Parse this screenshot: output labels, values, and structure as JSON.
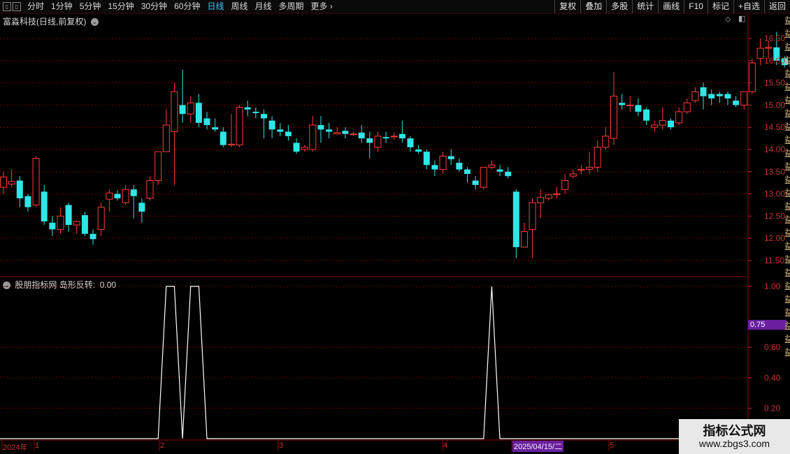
{
  "toolbar": {
    "periods": [
      "分时",
      "1分钟",
      "5分钟",
      "15分钟",
      "30分钟",
      "60分钟",
      "日线",
      "周线",
      "月线",
      "多周期",
      "更多"
    ],
    "active_period": "日线",
    "tools": [
      "复权",
      "叠加",
      "多股",
      "统计",
      "画线",
      "F10",
      "标记",
      "+自选",
      "返回"
    ]
  },
  "main_header": {
    "title": "富淼科技(日线,前复权)"
  },
  "indicator_header": {
    "name": "股朋指标网",
    "label": "岛形反转",
    "value": "0.00"
  },
  "price_axis": {
    "ticks": [
      "16.50",
      "16.00",
      "15.50",
      "15.00",
      "14.50",
      "14.00",
      "13.50",
      "13.00",
      "12.50",
      "12.00",
      "11.50"
    ]
  },
  "indicator_axis": {
    "ticks": [
      "1.00",
      "0.75",
      "0.60",
      "0.40",
      "0.20"
    ],
    "highlight": "0.75"
  },
  "date_axis": {
    "labels": [
      "2024年",
      "1",
      "2",
      "3",
      "4",
      "2025/04/15/二",
      "5"
    ],
    "highlight": "2025/04/15/二"
  },
  "right_strip_text": "益益益益益益益益益益益益益益益益益益益益益益益益益益",
  "watermark": {
    "title": "指标公式网",
    "url": "www.zbgs3.com"
  },
  "colors": {
    "up": "#ff3c3c",
    "down": "#2fe6e6",
    "grid": "#7a0000",
    "indicator_line": "#ffffff"
  },
  "chart_data": {
    "type": "candlestick",
    "title": "富淼科技(日线,前复权)",
    "ylim": [
      11.2,
      16.8
    ],
    "candles": [
      [
        13.15,
        13.38,
        13.5,
        13.0
      ],
      [
        13.22,
        13.28,
        13.55,
        13.15
      ],
      [
        13.3,
        12.9,
        13.4,
        12.7
      ],
      [
        12.95,
        12.7,
        13.0,
        12.6
      ],
      [
        12.75,
        13.8,
        13.85,
        12.7
      ],
      [
        13.05,
        12.38,
        13.2,
        12.3
      ],
      [
        12.35,
        12.2,
        12.5,
        12.05
      ],
      [
        12.2,
        12.5,
        12.7,
        12.1
      ],
      [
        12.75,
        12.3,
        12.8,
        12.15
      ],
      [
        12.3,
        12.38,
        12.4,
        12.1
      ],
      [
        12.52,
        12.1,
        12.6,
        12.05
      ],
      [
        12.1,
        11.98,
        12.2,
        11.85
      ],
      [
        12.2,
        12.7,
        12.8,
        12.05
      ],
      [
        12.88,
        13.02,
        13.1,
        12.6
      ],
      [
        13.0,
        12.9,
        13.08,
        12.85
      ],
      [
        12.8,
        13.1,
        13.2,
        12.75
      ],
      [
        13.1,
        12.95,
        13.2,
        12.45
      ],
      [
        12.8,
        12.6,
        12.9,
        12.35
      ],
      [
        12.9,
        13.3,
        13.4,
        12.85
      ],
      [
        13.3,
        13.95,
        13.95,
        13.2
      ],
      [
        13.95,
        14.55,
        14.9,
        13.95
      ],
      [
        14.4,
        15.3,
        15.5,
        13.2
      ],
      [
        15.0,
        14.8,
        15.8,
        14.6
      ],
      [
        14.8,
        15.05,
        15.2,
        14.6
      ],
      [
        15.05,
        14.6,
        15.25,
        14.5
      ],
      [
        14.7,
        14.55,
        14.85,
        14.45
      ],
      [
        14.5,
        14.45,
        14.7,
        14.4
      ],
      [
        14.4,
        14.1,
        14.5,
        14.05
      ],
      [
        14.1,
        14.12,
        14.8,
        14.05
      ],
      [
        14.1,
        14.95,
        15.0,
        14.05
      ],
      [
        14.95,
        14.9,
        15.1,
        14.75
      ],
      [
        14.85,
        14.82,
        14.95,
        14.7
      ],
      [
        14.8,
        14.7,
        14.9,
        14.25
      ],
      [
        14.65,
        14.45,
        14.75,
        14.25
      ],
      [
        14.45,
        14.4,
        14.6,
        14.3
      ],
      [
        14.4,
        14.3,
        14.55,
        14.2
      ],
      [
        14.15,
        13.95,
        14.25,
        13.9
      ],
      [
        14.0,
        14.05,
        14.1,
        13.95
      ],
      [
        14.0,
        14.55,
        14.75,
        13.95
      ],
      [
        14.55,
        14.45,
        14.75,
        14.15
      ],
      [
        14.45,
        14.4,
        14.6,
        14.25
      ],
      [
        14.35,
        14.38,
        14.5,
        14.35
      ],
      [
        14.42,
        14.35,
        14.5,
        14.25
      ],
      [
        14.35,
        14.35,
        14.4,
        14.3
      ],
      [
        14.38,
        14.25,
        14.55,
        14.15
      ],
      [
        14.25,
        14.15,
        14.4,
        13.8
      ],
      [
        14.05,
        14.3,
        14.4,
        13.95
      ],
      [
        14.28,
        14.25,
        14.4,
        14.15
      ],
      [
        14.3,
        14.3,
        14.38,
        14.22
      ],
      [
        14.35,
        14.25,
        14.65,
        14.15
      ],
      [
        14.25,
        14.05,
        14.3,
        13.95
      ],
      [
        14.0,
        13.95,
        14.1,
        13.9
      ],
      [
        13.95,
        13.65,
        14.0,
        13.55
      ],
      [
        13.65,
        13.55,
        13.75,
        13.4
      ],
      [
        13.55,
        13.85,
        13.95,
        13.45
      ],
      [
        13.85,
        13.78,
        14.0,
        13.65
      ],
      [
        13.7,
        13.55,
        13.8,
        13.5
      ],
      [
        13.55,
        13.45,
        13.6,
        13.25
      ],
      [
        13.3,
        13.2,
        13.4,
        13.1
      ],
      [
        13.15,
        13.6,
        13.6,
        13.1
      ],
      [
        13.6,
        13.65,
        13.75,
        13.55
      ],
      [
        13.55,
        13.5,
        13.65,
        13.4
      ],
      [
        13.5,
        13.4,
        13.6,
        13.35
      ],
      [
        13.05,
        11.8,
        13.1,
        11.55
      ],
      [
        11.8,
        12.15,
        12.35,
        11.8
      ],
      [
        12.2,
        12.8,
        12.9,
        11.55
      ],
      [
        12.8,
        12.92,
        13.1,
        12.45
      ],
      [
        12.9,
        12.98,
        13.0,
        12.85
      ],
      [
        13.0,
        13.0,
        13.15,
        12.9
      ],
      [
        13.1,
        13.3,
        13.45,
        13.0
      ],
      [
        13.4,
        13.45,
        13.55,
        13.35
      ],
      [
        13.55,
        13.55,
        13.65,
        13.45
      ],
      [
        13.55,
        13.6,
        13.95,
        13.45
      ],
      [
        13.6,
        14.05,
        14.2,
        13.5
      ],
      [
        14.05,
        14.3,
        14.5,
        14.0
      ],
      [
        14.25,
        15.2,
        15.75,
        14.1
      ],
      [
        15.05,
        15.0,
        15.25,
        14.9
      ],
      [
        15.0,
        15.0,
        15.2,
        14.85
      ],
      [
        15.0,
        14.85,
        15.15,
        14.75
      ],
      [
        14.9,
        14.65,
        14.95,
        14.55
      ],
      [
        14.5,
        14.55,
        14.65,
        14.4
      ],
      [
        14.55,
        14.65,
        14.95,
        14.45
      ],
      [
        14.65,
        14.5,
        14.7,
        14.45
      ],
      [
        14.6,
        14.85,
        14.95,
        14.55
      ],
      [
        14.85,
        15.05,
        15.15,
        14.8
      ],
      [
        15.1,
        15.3,
        15.4,
        15.05
      ],
      [
        15.4,
        15.2,
        15.5,
        14.9
      ],
      [
        15.25,
        15.15,
        15.35,
        15.0
      ],
      [
        15.25,
        15.2,
        15.3,
        15.05
      ],
      [
        15.25,
        15.15,
        15.3,
        15.0
      ],
      [
        15.1,
        15.0,
        15.2,
        14.95
      ],
      [
        15.0,
        15.3,
        15.3,
        14.9
      ],
      [
        15.3,
        15.95,
        16.05,
        15.25
      ],
      [
        16.05,
        16.28,
        16.5,
        15.9
      ],
      [
        16.28,
        16.3,
        16.45,
        16.05
      ],
      [
        16.3,
        16.0,
        16.65,
        15.9
      ],
      [
        16.05,
        15.9,
        16.1,
        15.85
      ],
      [
        15.9,
        15.85,
        16.0,
        15.75
      ],
      [
        15.95,
        16.2,
        16.3,
        15.8
      ],
      [
        16.2,
        16.2,
        16.45,
        16.05
      ],
      [
        16.05,
        16.35,
        16.4,
        16.0
      ],
      [
        16.38,
        16.5,
        16.55,
        16.2
      ]
    ],
    "series": [
      {
        "name": "岛形反转",
        "values_at": [
          [
            20,
            1
          ],
          [
            21,
            1
          ],
          [
            22,
            0
          ],
          [
            23,
            1
          ],
          [
            24,
            1
          ],
          [
            60,
            1
          ]
        ]
      }
    ],
    "indicator_ylim": [
      0,
      1.0
    ]
  }
}
